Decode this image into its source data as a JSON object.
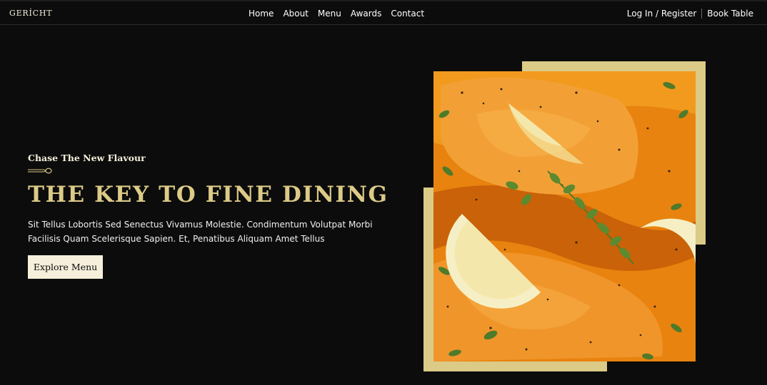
{
  "brand": {
    "logo": "GERÍCHT"
  },
  "nav": {
    "links": [
      "Home",
      "About",
      "Menu",
      "Awards",
      "Contact"
    ],
    "login": "Log In / Register",
    "book": "Book Table"
  },
  "hero": {
    "subtitle": "Chase The New Flavour",
    "title": "THE KEY TO FINE DINING",
    "description": "Sit Tellus Lobortis Sed Senectus Vivamus Molestie. Condimentum Volutpat Morbi Facilisis Quam Scelerisque Sapien. Et, Penatibus Aliquam Amet Tellus",
    "button": "Explore Menu"
  },
  "colors": {
    "background": "#0c0c0c",
    "golden": "#dcca87",
    "crimson": "#f5efdb",
    "text": "#ffffff"
  },
  "icons": {
    "divider": "spoon-icon"
  }
}
